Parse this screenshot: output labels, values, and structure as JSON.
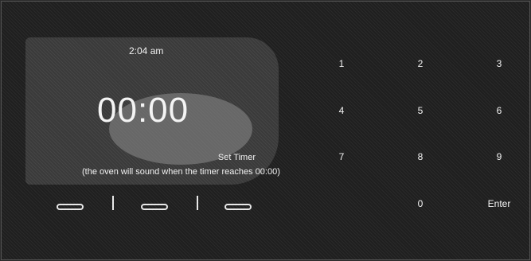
{
  "display": {
    "clock": "2:04 am",
    "timer": "00:00",
    "set_timer_label": "Set Timer",
    "hint": "(the oven will sound when the timer reaches 00:00)"
  },
  "keypad": {
    "keys": [
      "1",
      "2",
      "3",
      "4",
      "5",
      "6",
      "7",
      "8",
      "9",
      "0",
      "Enter"
    ]
  },
  "colors": {
    "background": "#1f1f1f",
    "panel": "#3a3a3a",
    "text": "#f4f4f4"
  }
}
